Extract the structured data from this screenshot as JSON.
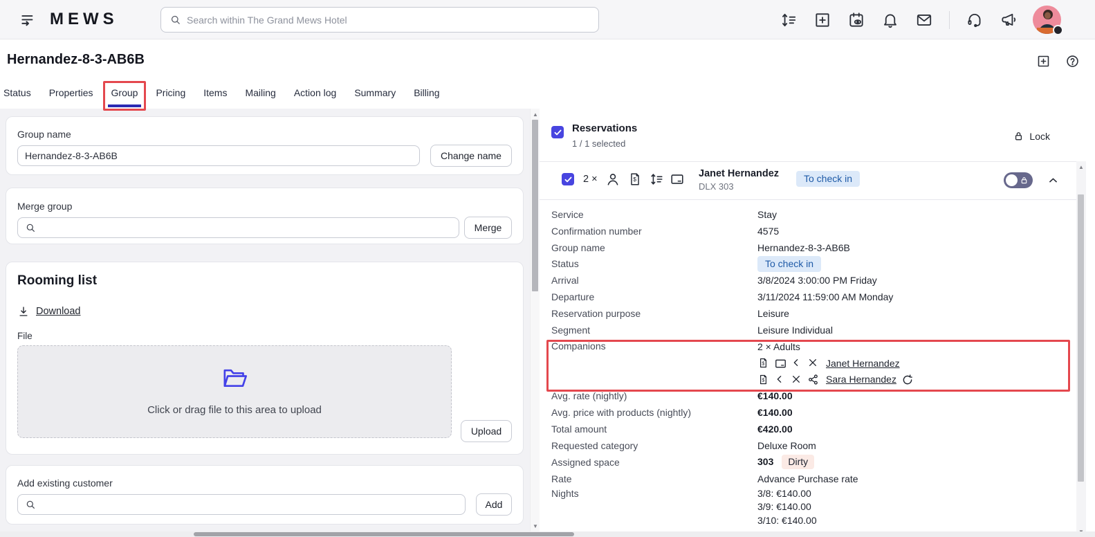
{
  "topbar": {
    "brand": "MEWS",
    "search_placeholder": "Search within The Grand Mews Hotel",
    "icons": [
      "sidebar-toggle-icon",
      "sort-list-icon",
      "add-icon",
      "calendar-eye-icon",
      "notifications-bell-icon",
      "messages-envelope-icon",
      "support-headset-icon",
      "announcements-megaphone-icon",
      "user-avatar"
    ]
  },
  "page": {
    "title": "Hernandez-8-3-AB6B",
    "header_icons": [
      "add-window-icon",
      "help-icon"
    ],
    "tabs": [
      "Status",
      "Properties",
      "Group",
      "Pricing",
      "Items",
      "Mailing",
      "Action log",
      "Summary",
      "Billing"
    ],
    "active_tab": "Group"
  },
  "left": {
    "group_name": {
      "label": "Group name",
      "value": "Hernandez-8-3-AB6B",
      "button": "Change name"
    },
    "merge_group": {
      "label": "Merge group",
      "button": "Merge"
    },
    "rooming_list": {
      "title": "Rooming list",
      "download": "Download",
      "file_label": "File",
      "dropzone_text": "Click or drag file to this area to upload",
      "upload_button": "Upload"
    },
    "add_customer": {
      "label": "Add existing customer",
      "button": "Add"
    }
  },
  "reservations": {
    "title": "Reservations",
    "selected": "1 / 1 selected",
    "lock_button": "Lock",
    "row": {
      "count": "2 ×",
      "icons": [
        "person-icon",
        "billing-icon",
        "sort-icon",
        "payment-card-icon"
      ],
      "guest": "Janet Hernandez",
      "space": "DLX 303",
      "status": "To check in"
    },
    "details": {
      "service": {
        "label": "Service",
        "value": "Stay"
      },
      "confirmation": {
        "label": "Confirmation number",
        "value": "4575"
      },
      "group_name": {
        "label": "Group name",
        "value": "Hernandez-8-3-AB6B"
      },
      "status": {
        "label": "Status",
        "value": "To check in"
      },
      "arrival": {
        "label": "Arrival",
        "value": "3/8/2024 3:00:00 PM Friday"
      },
      "departure": {
        "label": "Departure",
        "value": "3/11/2024 11:59:00 AM Monday"
      },
      "purpose": {
        "label": "Reservation purpose",
        "value": "Leisure"
      },
      "segment": {
        "label": "Segment",
        "value": "Leisure Individual"
      },
      "companions": {
        "label": "Companions",
        "count": "2 × Adults",
        "companion1": "Janet Hernandez",
        "companion1_icons": [
          "billing-icon",
          "payment-card-icon",
          "chevron-left-icon",
          "remove-icon"
        ],
        "companion2": "Sara Hernandez",
        "companion2_icons": [
          "billing-icon",
          "chevron-left-icon",
          "remove-icon",
          "share-icon",
          "refresh-icon"
        ]
      },
      "avg_rate": {
        "label": "Avg. rate (nightly)",
        "value": "€140.00"
      },
      "avg_price": {
        "label": "Avg. price with products (nightly)",
        "value": "€140.00"
      },
      "total": {
        "label": "Total amount",
        "value": "€420.00"
      },
      "requested_category": {
        "label": "Requested category",
        "value": "Deluxe Room"
      },
      "assigned_space": {
        "label": "Assigned space",
        "value": "303",
        "badge": "Dirty"
      },
      "rate": {
        "label": "Rate",
        "value": "Advance Purchase rate"
      },
      "nights": {
        "label": "Nights",
        "lines": [
          "3/8: €140.00",
          "3/9: €140.00",
          "3/10: €140.00"
        ]
      }
    }
  },
  "colors": {
    "accent_indigo": "#4845e0",
    "annotation_red": "#e4484e",
    "status_badge_bg": "#dce9f9",
    "status_badge_text": "#1e5aa7",
    "dirty_badge_bg": "#fbeae5",
    "folder_icon": "#4341e8",
    "topbar_bg": "#f6f6f8",
    "left_panel_bg": "#f2f2f5"
  }
}
